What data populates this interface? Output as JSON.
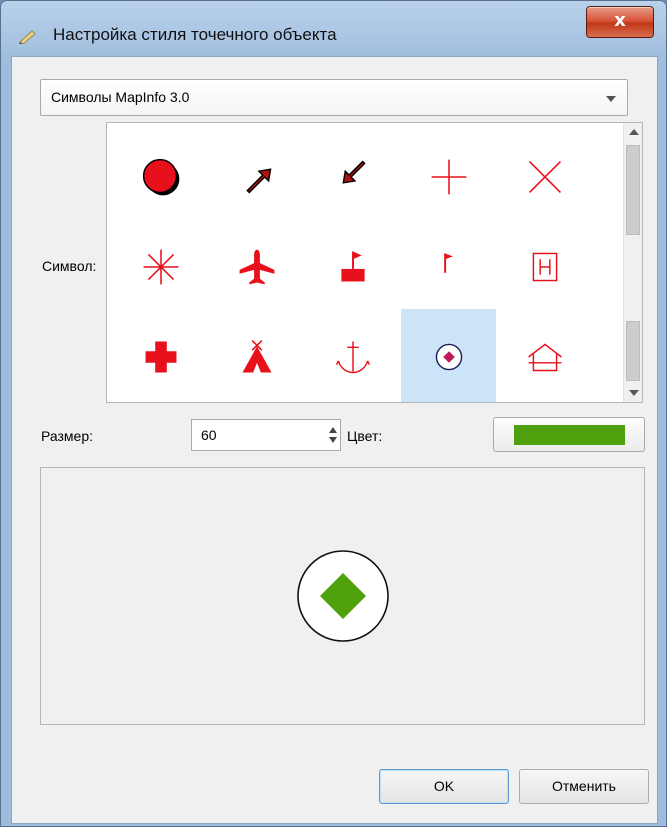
{
  "window": {
    "title": "Настройка стиля точечного объекта",
    "close_glyph": "x"
  },
  "combo": {
    "value": "Символы MapInfo 3.0"
  },
  "symbol": {
    "label": "Символ:",
    "items": [
      {
        "icon": "filled-circle-icon"
      },
      {
        "icon": "arrow-up-right-icon"
      },
      {
        "icon": "arrow-down-left-icon"
      },
      {
        "icon": "plus-icon"
      },
      {
        "icon": "x-cross-icon"
      },
      {
        "icon": "asterisk-icon"
      },
      {
        "icon": "airplane-icon"
      },
      {
        "icon": "flag-on-base-icon"
      },
      {
        "icon": "small-flag-icon"
      },
      {
        "icon": "hospital-h-icon"
      },
      {
        "icon": "red-cross-icon"
      },
      {
        "icon": "tent-icon"
      },
      {
        "icon": "anchor-icon"
      },
      {
        "icon": "diamond-in-circle-icon"
      },
      {
        "icon": "house-icon"
      }
    ],
    "selected_index": 13,
    "symbol_color": "#e8101a"
  },
  "size": {
    "label": "Размер:",
    "value": "60"
  },
  "color": {
    "label": "Цвет:",
    "value": "#4ea10c"
  },
  "buttons": {
    "ok": "OK",
    "cancel": "Отменить"
  }
}
